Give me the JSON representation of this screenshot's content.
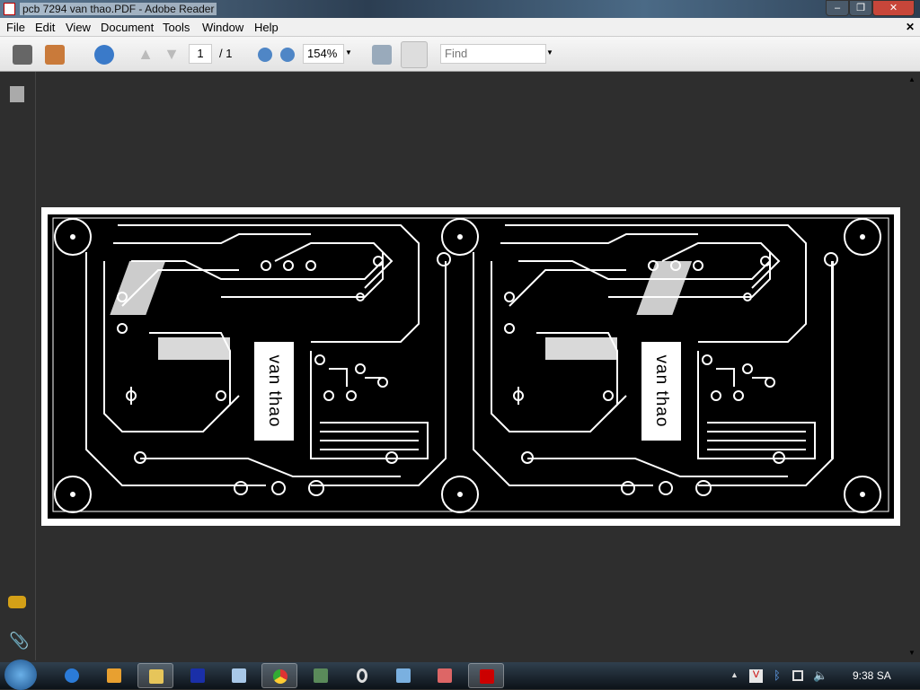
{
  "window": {
    "title": "pcb 7294 van thao.PDF - Adobe Reader",
    "minimize": "‒",
    "maximize": "❐",
    "close": "✕",
    "doc_close": "✕"
  },
  "menu": [
    "File",
    "Edit",
    "View",
    "Document",
    "Tools",
    "Window",
    "Help"
  ],
  "toolbar": {
    "page_current": "1",
    "page_total": "/ 1",
    "zoom": "154%",
    "find_placeholder": "Find"
  },
  "pcb": {
    "label": "van thao"
  },
  "taskbar": {
    "clock": "9:38 SA"
  }
}
